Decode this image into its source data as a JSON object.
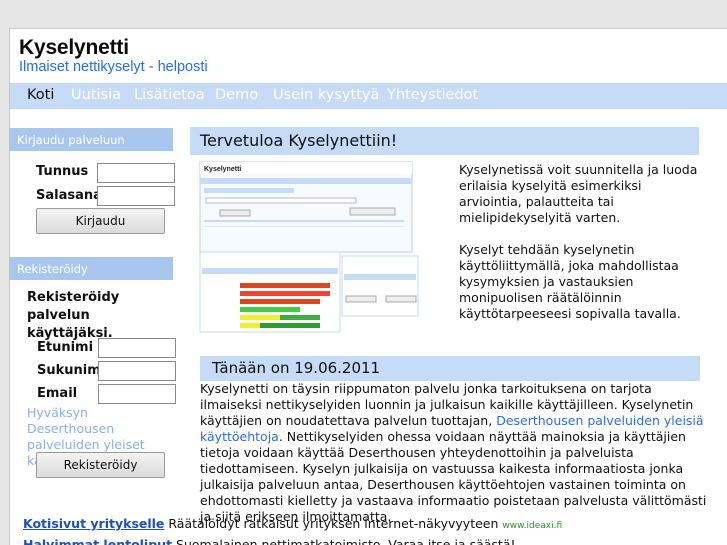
{
  "header": {
    "title": "Kyselynetti",
    "tagline": "Ilmaiset nettikyselyt - helposti"
  },
  "nav": {
    "items": [
      "Koti",
      "Uutisia",
      "Lisätietoa",
      "Demo",
      "Usein kysyttyä",
      "Yhteystiedot"
    ],
    "active": "Koti"
  },
  "login": {
    "heading": "Kirjaudu palveluun",
    "username_label": "Tunnus",
    "password_label": "Salasana",
    "submit_label": "Kirjaudu"
  },
  "register": {
    "heading": "Rekisteröidy",
    "intro": "Rekisteröidy palvelun käyttäjäksi.",
    "firstname_label": "Etunimi",
    "lastname_label": "Sukunimi",
    "email_label": "Email",
    "terms_text": "Hyväksyn Deserthousen palveluiden yleiset käyttöehdot",
    "submit_label": "Rekisteröidy"
  },
  "welcome": {
    "heading": "Tervetuloa Kyselynettiin!",
    "paragraph1": "Kyselynetissä voit suunnitella ja luoda erilaisia kyselyitä esimerkiksi arviointia, palautteita tai mielipidekyselyitä varten.",
    "paragraph2": "Kyselyt tehdään kyselynetin käyttöliittymällä, joka mahdollistaa kysymyksien ja vastauksien monipuolisen räätälöinnin käyttötarpeeseesi sopivalla tavalla."
  },
  "today": {
    "heading": "Tänään on 19.06.2011",
    "text_before_link": "Kyselynetti on täysin riippumaton palvelu jonka tarkoituksena on tarjota ilmaiseksi nettikyselyiden luonnin ja julkaisun kaikille käyttäjilleen. Kyselynetin käyttäjien on noudatettava palvelun tuottajan,",
    "link_text": "Deserthousen palveluiden yleisiä käyttöehtoja",
    "text_after_link": ". Nettikyselyiden ohessa voidaan näyttää mainoksia ja käyttäjien tietoja voidaan käyttää Deserthousen yhteydenottoihin ja palveluista tiedottamiseen. Kyselyn julkaisija on vastuussa kaikesta informaatiosta jonka julkaisija palveluun antaa, Deserthousen käyttöehtojen vastainen toiminta on ehdottomasti kielletty ja vastaava informaatio poistetaan palvelusta välittömästi ja siitä erikseen ilmoittamatta."
  },
  "ads": [
    {
      "title": "Kotisivut yritykselle",
      "text": " Räätälöidyt ratkaisut yrityksen internet-näkyvyyteen ",
      "url": "www.ideaxi.fi"
    },
    {
      "title": "Halvimmat lentoliput",
      "text": " Suomalainen nettimatkatoimisto. Varaa itse ja säästä!",
      "url": ""
    }
  ]
}
